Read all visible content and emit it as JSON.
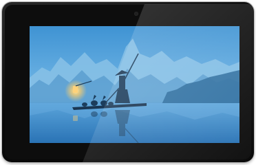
{
  "device": {
    "type": "tablet",
    "orientation": "landscape",
    "bezel_color": "#0b0b0b"
  },
  "screen": {
    "scene": "fisherman-on-raft-with-lantern",
    "palette": {
      "sky_top": "#3b8fd0",
      "sky_bottom": "#6fb6e6",
      "mountain_far": "#7fbbe2",
      "mountain_mid": "#5a9ccd",
      "water": "#2f7fc0",
      "silhouette": "#1c3d5c",
      "lantern": "#ffd27a"
    }
  }
}
